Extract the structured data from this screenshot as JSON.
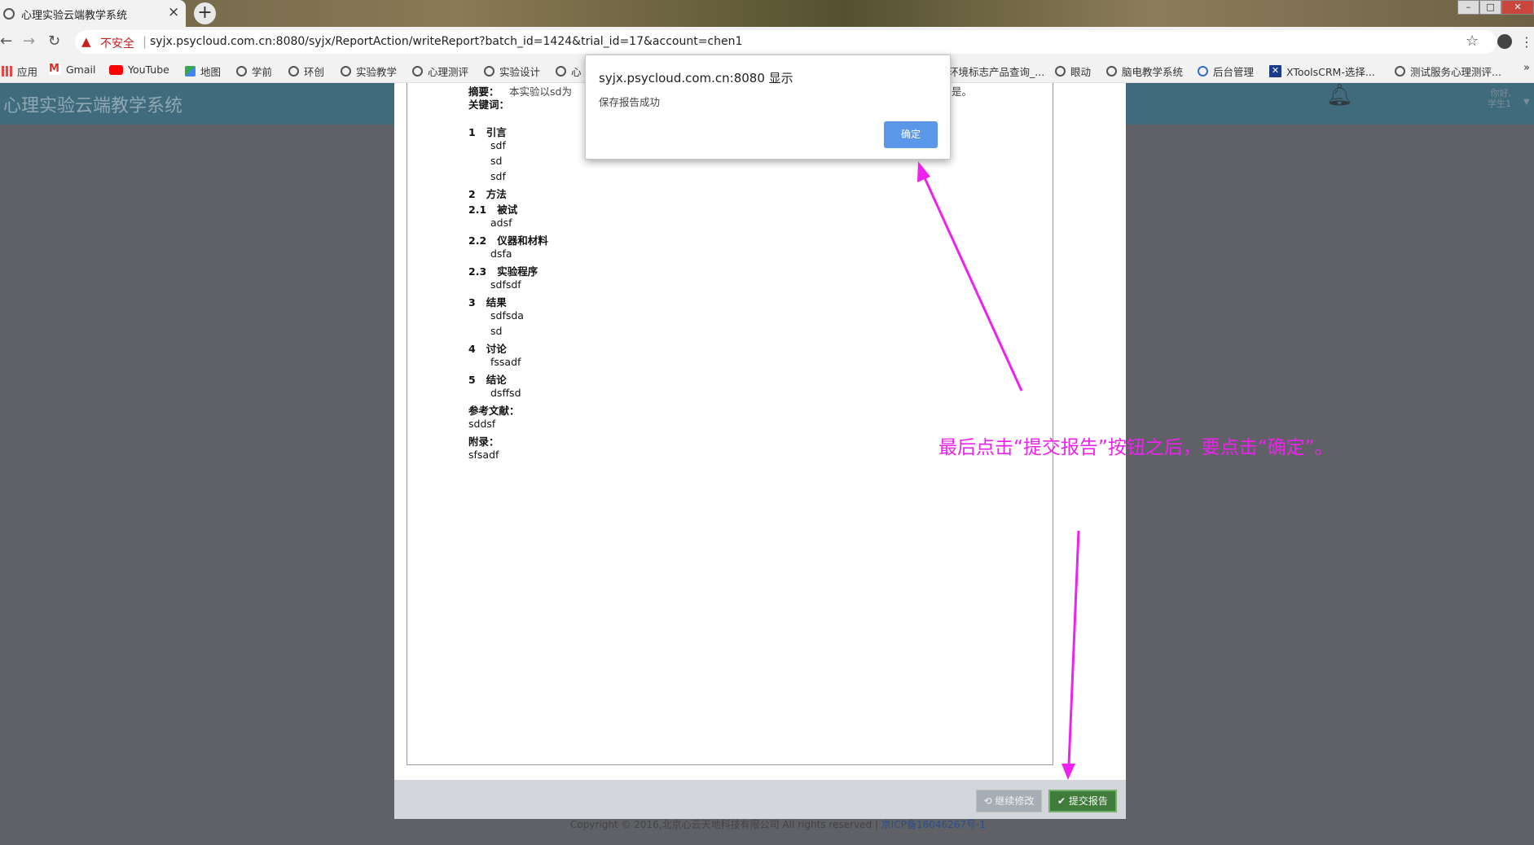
{
  "browser": {
    "tab_title": "心理实验云端教学系统",
    "tab_close": "×",
    "new_tab": "+",
    "window_controls": [
      "–",
      "□",
      "✕"
    ],
    "insecure_label": "不安全",
    "url": "syjx.psycloud.com.cn:8080/syjx/ReportAction/writeReport?batch_id=1424&trial_id=17&account=chen1"
  },
  "bookmarks": [
    {
      "label": "应用",
      "icon": "apps-icon"
    },
    {
      "label": "Gmail",
      "icon": "gmail-icon"
    },
    {
      "label": "YouTube",
      "icon": "youtube-icon"
    },
    {
      "label": "地图",
      "icon": "maps-icon"
    },
    {
      "label": "学前",
      "icon": "globe-icon"
    },
    {
      "label": "环创",
      "icon": "globe-icon"
    },
    {
      "label": "实验教学",
      "icon": "globe-icon"
    },
    {
      "label": "心理测评",
      "icon": "globe-icon"
    },
    {
      "label": "实验设计",
      "icon": "globe-icon"
    },
    {
      "label": "心",
      "icon": "globe-icon"
    },
    {
      "label": "环境标志产品查询_...",
      "icon": "none"
    },
    {
      "label": "眼动",
      "icon": "globe-icon"
    },
    {
      "label": "脑电教学系统",
      "icon": "globe-icon"
    },
    {
      "label": "后台管理",
      "icon": "globe-icon"
    },
    {
      "label": "XToolsCRM-选择...",
      "icon": "xtools-icon"
    },
    {
      "label": "测试服务心理测评...",
      "icon": "globe-icon"
    }
  ],
  "header": {
    "site_title": "心理实验云端教学系统",
    "greeting_1": "你好,",
    "greeting_2": "学生1"
  },
  "report": {
    "abstract_label": "摘要：",
    "abstract_text": "本实验以sd为",
    "abstract_tail": "是。",
    "keywords_label": "关键词：",
    "sections": [
      {
        "num": "1",
        "title": "引言",
        "bold": true
      },
      {
        "text": "sdf"
      },
      {
        "text": "sd"
      },
      {
        "text": "sdf"
      },
      {
        "num": "2",
        "title": "方法",
        "bold": true
      },
      {
        "num": "2.1",
        "title": "被试",
        "bold": true
      },
      {
        "text": "adsf"
      },
      {
        "num": "2.2",
        "title": "仪器和材料",
        "bold": true
      },
      {
        "text": "dsfa"
      },
      {
        "num": "2.3",
        "title": "实验程序",
        "bold": true
      },
      {
        "text": "sdfsdf"
      },
      {
        "num": "3",
        "title": "结果",
        "bold": true
      },
      {
        "text": "sdfsda"
      },
      {
        "text": "sd"
      },
      {
        "num": "4",
        "title": "讨论",
        "bold": true
      },
      {
        "text": "fssadf"
      },
      {
        "num": "5",
        "title": "结论",
        "bold": true
      },
      {
        "text": "dsffsd"
      }
    ],
    "references_label": "参考文献：",
    "references_text": "sddsf",
    "appendix_label": "附录：",
    "appendix_text": "sfsadf"
  },
  "footer": {
    "continue_label": "继续修改",
    "submit_label": "提交报告",
    "copyright": "Copyright © 2016,北京心云天地科技有限公司 All rights reserved |",
    "icp": "京ICP备16046267号-1"
  },
  "dialog": {
    "title": "syjx.psycloud.com.cn:8080 显示",
    "message": "保存报告成功",
    "ok_label": "确定"
  },
  "annotation": {
    "text": "最后点击“提交报告”按钮之后，要点击“确定”。",
    "color": "#ee22ee"
  }
}
